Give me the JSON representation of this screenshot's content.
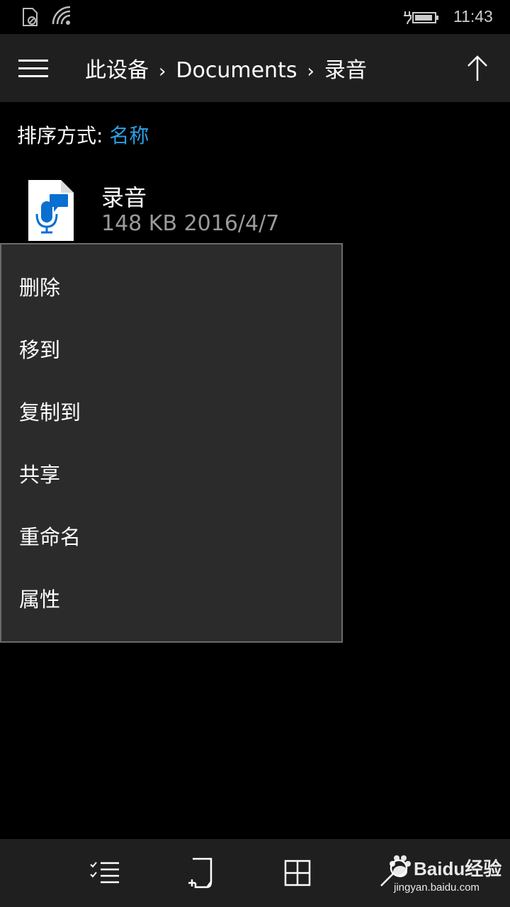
{
  "status_bar": {
    "icons": [
      "sim-no-service-icon",
      "wifi-icon",
      "battery-charging-icon"
    ],
    "time": "11:43"
  },
  "header": {
    "breadcrumb": [
      "此设备",
      "Documents",
      "录音"
    ],
    "separator": "›",
    "icons": [
      "hamburger-menu-icon",
      "arrow-up-icon"
    ]
  },
  "sort": {
    "label": "排序方式: ",
    "value": "名称"
  },
  "file": {
    "name": "录音",
    "meta": "148 KB  2016/4/7",
    "icon": "voice-recording-file-icon"
  },
  "context_menu": {
    "items": [
      "删除",
      "移到",
      "复制到",
      "共享",
      "重命名",
      "属性"
    ]
  },
  "app_bar": {
    "icons": [
      "select-list-icon",
      "new-folder-icon",
      "tile-view-icon",
      "search-icon"
    ]
  },
  "watermark": {
    "brand": "Baidu经验",
    "url": "jingyan.baidu.com"
  },
  "colors": {
    "accent": "#2aa0e6",
    "header_bg": "#1f1f1f",
    "menu_bg": "#2b2b2b",
    "meta_text": "#9a9a9a"
  }
}
